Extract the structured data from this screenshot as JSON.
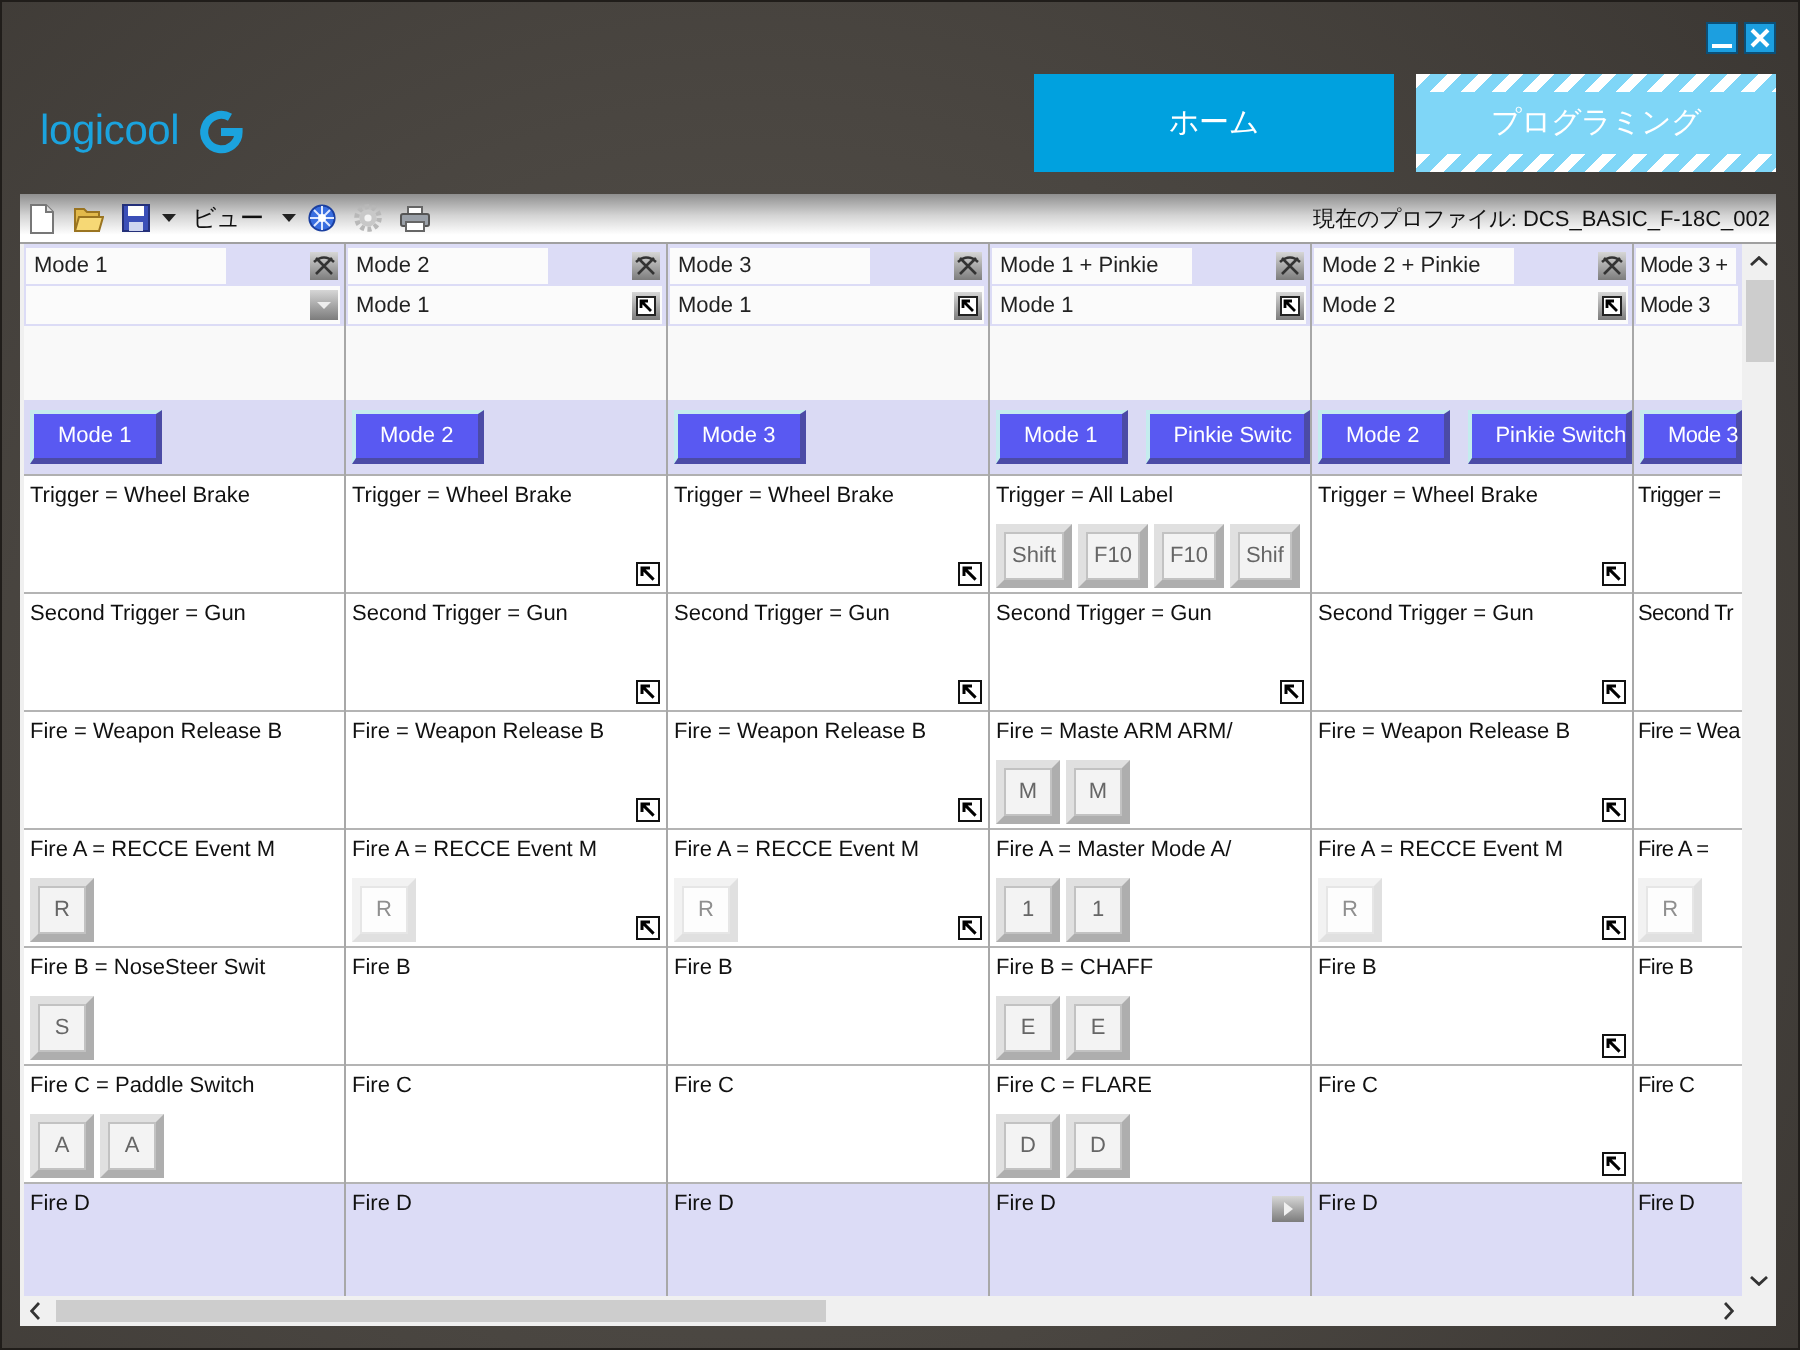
{
  "logo": {
    "text": "logicool"
  },
  "nav_tabs": [
    {
      "label": "ホーム",
      "selected": false
    },
    {
      "label": "プログラミング",
      "selected": true
    }
  ],
  "toolbar": {
    "view_menu": "ビュー",
    "profile": "現在のプロファイル: DCS_BASIC_F-18C_002"
  },
  "columns": [
    {
      "kind": "full",
      "mode": "Mode 1",
      "base": {
        "kind": "dropdown"
      },
      "mode_buttons": [
        "Mode 1"
      ],
      "cells": [
        {
          "text": "Trigger = Wheel Brake",
          "selected": false
        },
        {
          "text": "Second Trigger = Gun",
          "selected": false
        },
        {
          "text": "Fire = Weapon Release B",
          "selected": false
        },
        {
          "text": "Fire A = RECCE Event M",
          "keys": [
            {
              "label": "R",
              "disabled": false
            }
          ],
          "selected": false
        },
        {
          "text": "Fire B = NoseSteer Swit",
          "keys": [
            {
              "label": "S",
              "disabled": false
            }
          ],
          "selected": false
        },
        {
          "text": "Fire C = Paddle Switch",
          "keys": [
            {
              "label": "A",
              "disabled": false
            },
            {
              "label": "A",
              "disabled": false
            }
          ],
          "selected": false
        },
        {
          "text": "Fire D",
          "selected": true
        }
      ]
    },
    {
      "kind": "full",
      "mode": "Mode 2",
      "base": {
        "kind": "link",
        "text": "Mode 1"
      },
      "mode_buttons": [
        "Mode 2"
      ],
      "cells": [
        {
          "text": "Trigger = Wheel Brake",
          "corner": {
            "kind": "link"
          },
          "selected": false
        },
        {
          "text": "Second Trigger = Gun",
          "corner": {
            "kind": "link"
          },
          "selected": false
        },
        {
          "text": "Fire = Weapon Release B",
          "corner": {
            "kind": "link"
          },
          "selected": false
        },
        {
          "text": "Fire A = RECCE Event M",
          "keys": [
            {
              "label": "R",
              "disabled": true
            }
          ],
          "corner": {
            "kind": "link"
          },
          "selected": false
        },
        {
          "text": "Fire B",
          "selected": false
        },
        {
          "text": "Fire C",
          "selected": false
        },
        {
          "text": "Fire D",
          "selected": true
        }
      ]
    },
    {
      "kind": "full",
      "mode": "Mode 3",
      "base": {
        "kind": "link",
        "text": "Mode 1"
      },
      "mode_buttons": [
        "Mode 3"
      ],
      "cells": [
        {
          "text": "Trigger = Wheel Brake",
          "corner": {
            "kind": "link"
          },
          "selected": false
        },
        {
          "text": "Second Trigger = Gun",
          "corner": {
            "kind": "link"
          },
          "selected": false
        },
        {
          "text": "Fire = Weapon Release B",
          "corner": {
            "kind": "link"
          },
          "selected": false
        },
        {
          "text": "Fire A = RECCE Event M",
          "keys": [
            {
              "label": "R",
              "disabled": true
            }
          ],
          "corner": {
            "kind": "link"
          },
          "selected": false
        },
        {
          "text": "Fire B",
          "selected": false
        },
        {
          "text": "Fire C",
          "selected": false
        },
        {
          "text": "Fire D",
          "selected": true
        }
      ]
    },
    {
      "kind": "full",
      "mode": "Mode 1 + Pinkie",
      "base": {
        "kind": "link",
        "text": "Mode 1"
      },
      "mode_buttons": [
        "Mode 1",
        "Pinkie Switc"
      ],
      "cells": [
        {
          "text": "Trigger = All Label",
          "keys": [
            {
              "label": "Shift",
              "disabled": false
            },
            {
              "label": "F10",
              "disabled": false
            },
            {
              "label": "F10",
              "disabled": false
            },
            {
              "label": "Shif",
              "disabled": false
            }
          ],
          "selected": false
        },
        {
          "text": "Second Trigger = Gun",
          "corner": {
            "kind": "link"
          },
          "selected": false
        },
        {
          "text": "Fire = Maste ARM ARM/",
          "keys": [
            {
              "label": "M",
              "disabled": false
            },
            {
              "label": "M",
              "disabled": false
            }
          ],
          "selected": false
        },
        {
          "text": "Fire A = Master Mode A/",
          "keys": [
            {
              "label": "1",
              "disabled": false
            },
            {
              "label": "1",
              "disabled": false
            }
          ],
          "selected": false
        },
        {
          "text": "Fire B = CHAFF",
          "keys": [
            {
              "label": "E",
              "disabled": false
            },
            {
              "label": "E",
              "disabled": false
            }
          ],
          "selected": false
        },
        {
          "text": "Fire C = FLARE",
          "keys": [
            {
              "label": "D",
              "disabled": false
            },
            {
              "label": "D",
              "disabled": false
            }
          ],
          "selected": false
        },
        {
          "text": "Fire D",
          "corner": {
            "kind": "play"
          },
          "selected": true
        }
      ]
    },
    {
      "kind": "full",
      "mode": "Mode 2 + Pinkie",
      "base": {
        "kind": "link",
        "text": "Mode 2"
      },
      "mode_buttons": [
        "Mode 2",
        "Pinkie Switch"
      ],
      "cells": [
        {
          "text": "Trigger = Wheel Brake",
          "corner": {
            "kind": "link"
          },
          "selected": false
        },
        {
          "text": "Second Trigger = Gun",
          "corner": {
            "kind": "link"
          },
          "selected": false
        },
        {
          "text": "Fire = Weapon Release B",
          "corner": {
            "kind": "link"
          },
          "selected": false
        },
        {
          "text": "Fire A = RECCE Event M",
          "keys": [
            {
              "label": "R",
              "disabled": true
            }
          ],
          "corner": {
            "kind": "link"
          },
          "selected": false
        },
        {
          "text": "Fire B",
          "corner": {
            "kind": "link"
          },
          "selected": false
        },
        {
          "text": "Fire C",
          "corner": {
            "kind": "link"
          },
          "selected": false
        },
        {
          "text": "Fire D",
          "selected": true
        }
      ]
    },
    {
      "kind": "clipped",
      "mode": "Mode 3 +",
      "base": {
        "kind": "link",
        "text": "Mode 3"
      },
      "mode_buttons": [
        "Mode 3"
      ],
      "cells": [
        {
          "text": "Trigger =",
          "selected": false
        },
        {
          "text": "Second Tr",
          "selected": false
        },
        {
          "text": "Fire = Wea",
          "selected": false
        },
        {
          "text": "Fire A =",
          "keys": [
            {
              "label": "R",
              "disabled": true
            }
          ],
          "selected": false
        },
        {
          "text": "Fire B",
          "selected": false
        },
        {
          "text": "Fire C",
          "selected": false
        },
        {
          "text": "Fire D",
          "selected": true
        }
      ]
    }
  ]
}
